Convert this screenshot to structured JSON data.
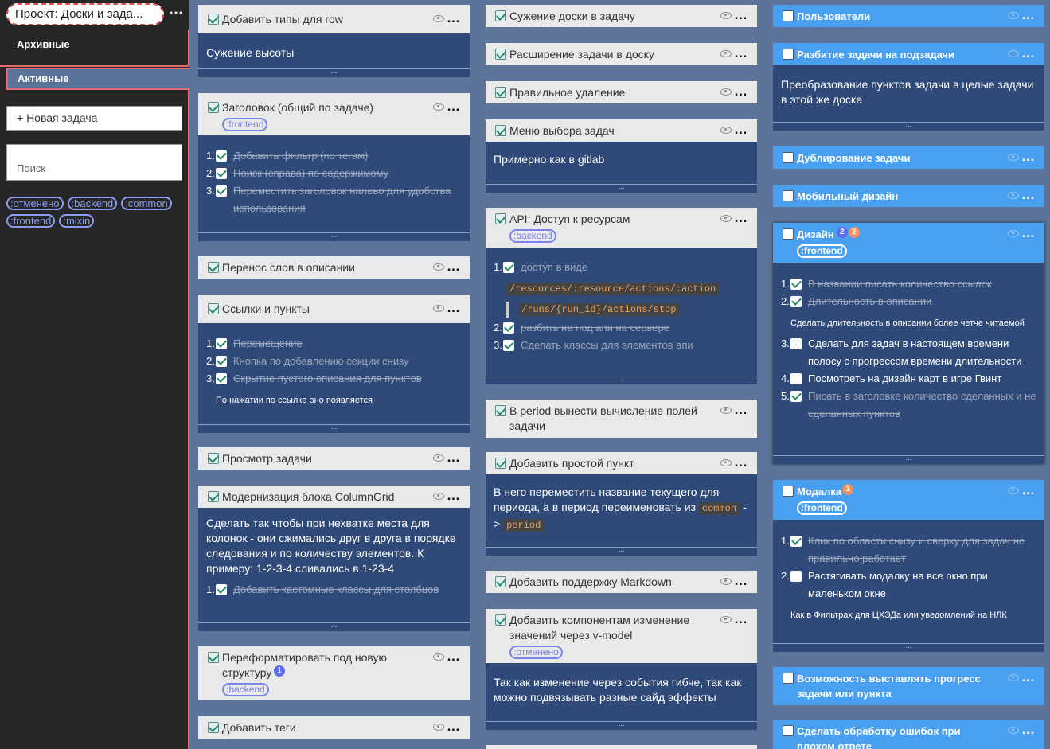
{
  "sidebar": {
    "project_title": "Проект: Доски и зада...",
    "archive_label": "Архивные",
    "active_label": "Активные",
    "new_task_label": "+ Новая задача",
    "search_placeholder": "Поиск",
    "tags": [
      ":отменено",
      ":backend",
      ":common",
      ":frontend",
      ":mixin"
    ]
  },
  "col1": {
    "c1": {
      "title": "Добавить типы для row",
      "text": "Сужение высоты"
    },
    "c2": {
      "title": "Заголовок (общий по задаче)",
      "tag": ":frontend",
      "items": [
        "Добавить фильтр (по тегам)",
        "Поиск (справа) по содержимому",
        "Переместить заголовок налево для удобства использования"
      ]
    },
    "c3": {
      "title": "Перенос слов в описании"
    },
    "c4": {
      "title": "Ссылки и пункты",
      "items": [
        "Перемещение",
        "Кнопка по добавлению секции снизу",
        "Скрытие пустого описания для пунктов"
      ],
      "note": "По нажатии по ссылке оно появляется"
    },
    "c5": {
      "title": "Просмотр задачи"
    },
    "c6": {
      "title": "Модернизация блока ColumnGrid",
      "text": "Сделать так чтобы при нехватке места для колонок - они сжимались друг в друга в порядке следования и по количеству элементов. К примеру: 1-2-3-4 сливались в 1-23-4",
      "items": [
        "Добавить кастомные классы для столбцов"
      ]
    },
    "c7": {
      "title": "Переформатировать под новую структуру",
      "badge": "1",
      "tag": ":backend"
    },
    "c8": {
      "title": "Добавить теги"
    }
  },
  "col2": {
    "c1": {
      "title": "Сужение доски в задачу"
    },
    "c2": {
      "title": "Расширение задачи в доску"
    },
    "c3": {
      "title": "Правильное удаление"
    },
    "c4": {
      "title": "Меню выбора задач",
      "text": "Примерно как в gitlab"
    },
    "c5": {
      "title": "API: Доступ к ресурсам",
      "tag": ":backend",
      "item1": "доступ в виде",
      "code1": "/resources/:resource/actions/:action",
      "code2": "/runs/{run_id}/actions/stop",
      "item2": "разбить на под апи на сервере",
      "item3": "Сделать классы для элементов апи"
    },
    "c6": {
      "title": "В period вынести вычисление полей задачи"
    },
    "c7": {
      "title": "Добавить простой пункт",
      "text_a": "В него переместить название текущего для периода, а в период переименовать из ",
      "code_a": "common",
      "text_b": " - > ",
      "code_b": "period"
    },
    "c8": {
      "title": "Добавить поддержку Markdown"
    },
    "c9": {
      "title": "Добавить компонентам изменение значений через v-model",
      "tag": ":отменено",
      "text": "Так как изменение через события гибче, так как можно подвязывать разные сайд эффекты"
    }
  },
  "col3": {
    "c1": {
      "title": "Пользователи"
    },
    "c2": {
      "title": "Разбитие задачи на подзадачи",
      "text": "Преобразование пунктов задачи в целые задачи в этой же доске"
    },
    "c3": {
      "title": "Дублирование задачи"
    },
    "c4": {
      "title": "Мобильный дизайн"
    },
    "c5": {
      "title": "Дизайн",
      "badge1": "2",
      "badge2": "2",
      "tag": ":frontend",
      "items": [
        "В названии писать количество ссылок",
        "Длительность в описании",
        "Сделать для задач в настоящем времени полосу с прогрессом времени длительности",
        "Посмотреть на дизайн карт в игре Гвинт",
        "Писать в заголовке количество сделанных и не сделанных пунктов"
      ],
      "note": "Сделать длительность в описании более четче читаемой"
    },
    "c6": {
      "title": "Модалка",
      "badge": "1",
      "tag": ":frontend",
      "items": [
        "Клик по области снизу и сверху для задач не правильно работает",
        "Растягивать модалку на все окно при маленьком окне"
      ],
      "note": "Как в Фильтрах для ЦХЭДа или уведомлений на НЛК"
    },
    "c7": {
      "title": "Возможность выставлять прогресс задачи или пункта"
    },
    "c8": {
      "title": "Сделать обработку ошибок при плохом ответе"
    }
  },
  "footer_dots": "...",
  "colors": {
    "bg": "#5c7499",
    "card": "#2f4a78",
    "header": "#e9e9e9",
    "blue_header": "#4aa0f0",
    "tag": "#8c9cf0",
    "sidebar": "#262626"
  }
}
